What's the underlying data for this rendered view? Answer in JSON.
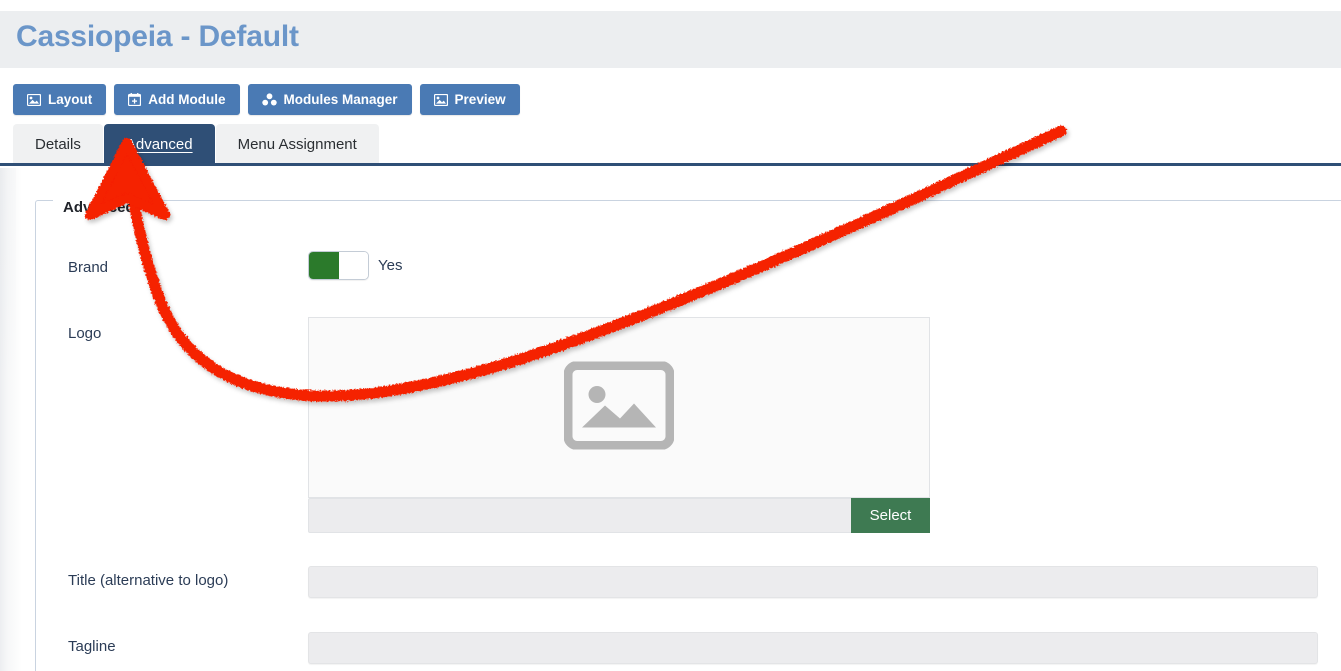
{
  "header": {
    "title": "Cassiopeia - Default"
  },
  "toolbar": {
    "buttons": [
      {
        "label": "Layout",
        "icon": "image-icon"
      },
      {
        "label": "Add Module",
        "icon": "calendar-plus-icon"
      },
      {
        "label": "Modules Manager",
        "icon": "cubes-icon"
      },
      {
        "label": "Preview",
        "icon": "image-icon"
      }
    ]
  },
  "tabs": [
    {
      "label": "Details",
      "active": false
    },
    {
      "label": "Advanced",
      "active": true
    },
    {
      "label": "Menu Assignment",
      "active": false
    }
  ],
  "form": {
    "legend": "Advanced",
    "fields": {
      "brand": {
        "label": "Brand",
        "toggle_value": "Yes"
      },
      "logo": {
        "label": "Logo",
        "placeholder_icon": "image-placeholder-icon",
        "path_value": "",
        "select_button": "Select"
      },
      "title": {
        "label": "Title (alternative to logo)",
        "value": ""
      },
      "tagline": {
        "label": "Tagline",
        "value": ""
      }
    }
  },
  "annotation": {
    "type": "curved-arrow",
    "color": "#f52000",
    "points_to": "Advanced"
  },
  "colors": {
    "header_band": "#eceef0",
    "header_title": "#6b96c9",
    "toolbar_button": "#4a7ab4",
    "active_tab": "#2f4f76",
    "inactive_tab": "#f0f1f2",
    "toggle_on": "#2b7a2b",
    "select_button": "#3e7a52",
    "label_text": "#2b3c56",
    "field_bg": "#ececee",
    "fieldset_border": "#c9d3e0",
    "annotation_red": "#f52000"
  }
}
